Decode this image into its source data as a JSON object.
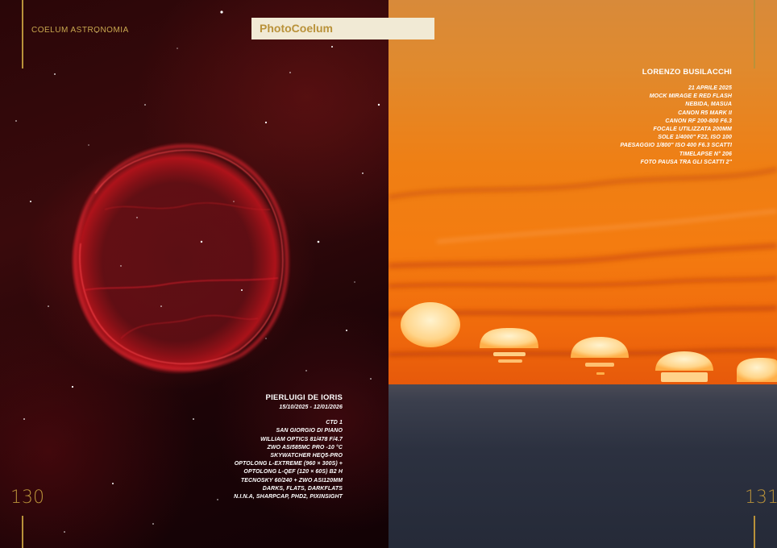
{
  "header": {
    "magazine": "COELUM ASTRONOMIA",
    "section": "PhotoCoelum"
  },
  "left_page": {
    "page_number": "130",
    "caption": {
      "author": "PIERLUIGI DE IORIS",
      "dates": "15/10/2025 - 12/01/2026",
      "lines": [
        "CTD 1",
        "SAN GIORGIO DI PIANO",
        "WILLIAM OPTICS 81/478 F/4.7",
        "ZWO ASI585MC PRO -10 °C",
        "SKYWATCHER HEQ5-PRO",
        "OPTOLONG L-EXTREME (960 × 300S) +",
        "OPTOLONG L-QEF (120 × 60S) B2 H",
        "TECNOSKY 60/240 + ZWO ASI120MM",
        "DARKS, FLATS, DARKFLATS",
        "N.I.N.A, SHARPCAP, PHD2, PIXINSIGHT"
      ]
    }
  },
  "right_page": {
    "page_number": "131",
    "caption": {
      "author": "LORENZO BUSILACCHI",
      "lines": [
        "21 APRILE 2025",
        "MOCK MIRAGE E RED FLASH",
        "NEBIDA, MASUA",
        "CANON R5 MARK II",
        "CANON RF 200-800 F6.3",
        "FOCALE UTILIZZATA 200MM",
        "SOLE 1/4000\" F22, ISO 100",
        "PAESAGGIO 1/800\" ISO 400 F6.3 SCATTI",
        "TIMELAPSE N° 206",
        "FOTO PAUSA TRA GLI SCATTI 2\""
      ]
    }
  },
  "colors": {
    "gold": "#b9923a",
    "banner_bg": "#f1ead5"
  }
}
